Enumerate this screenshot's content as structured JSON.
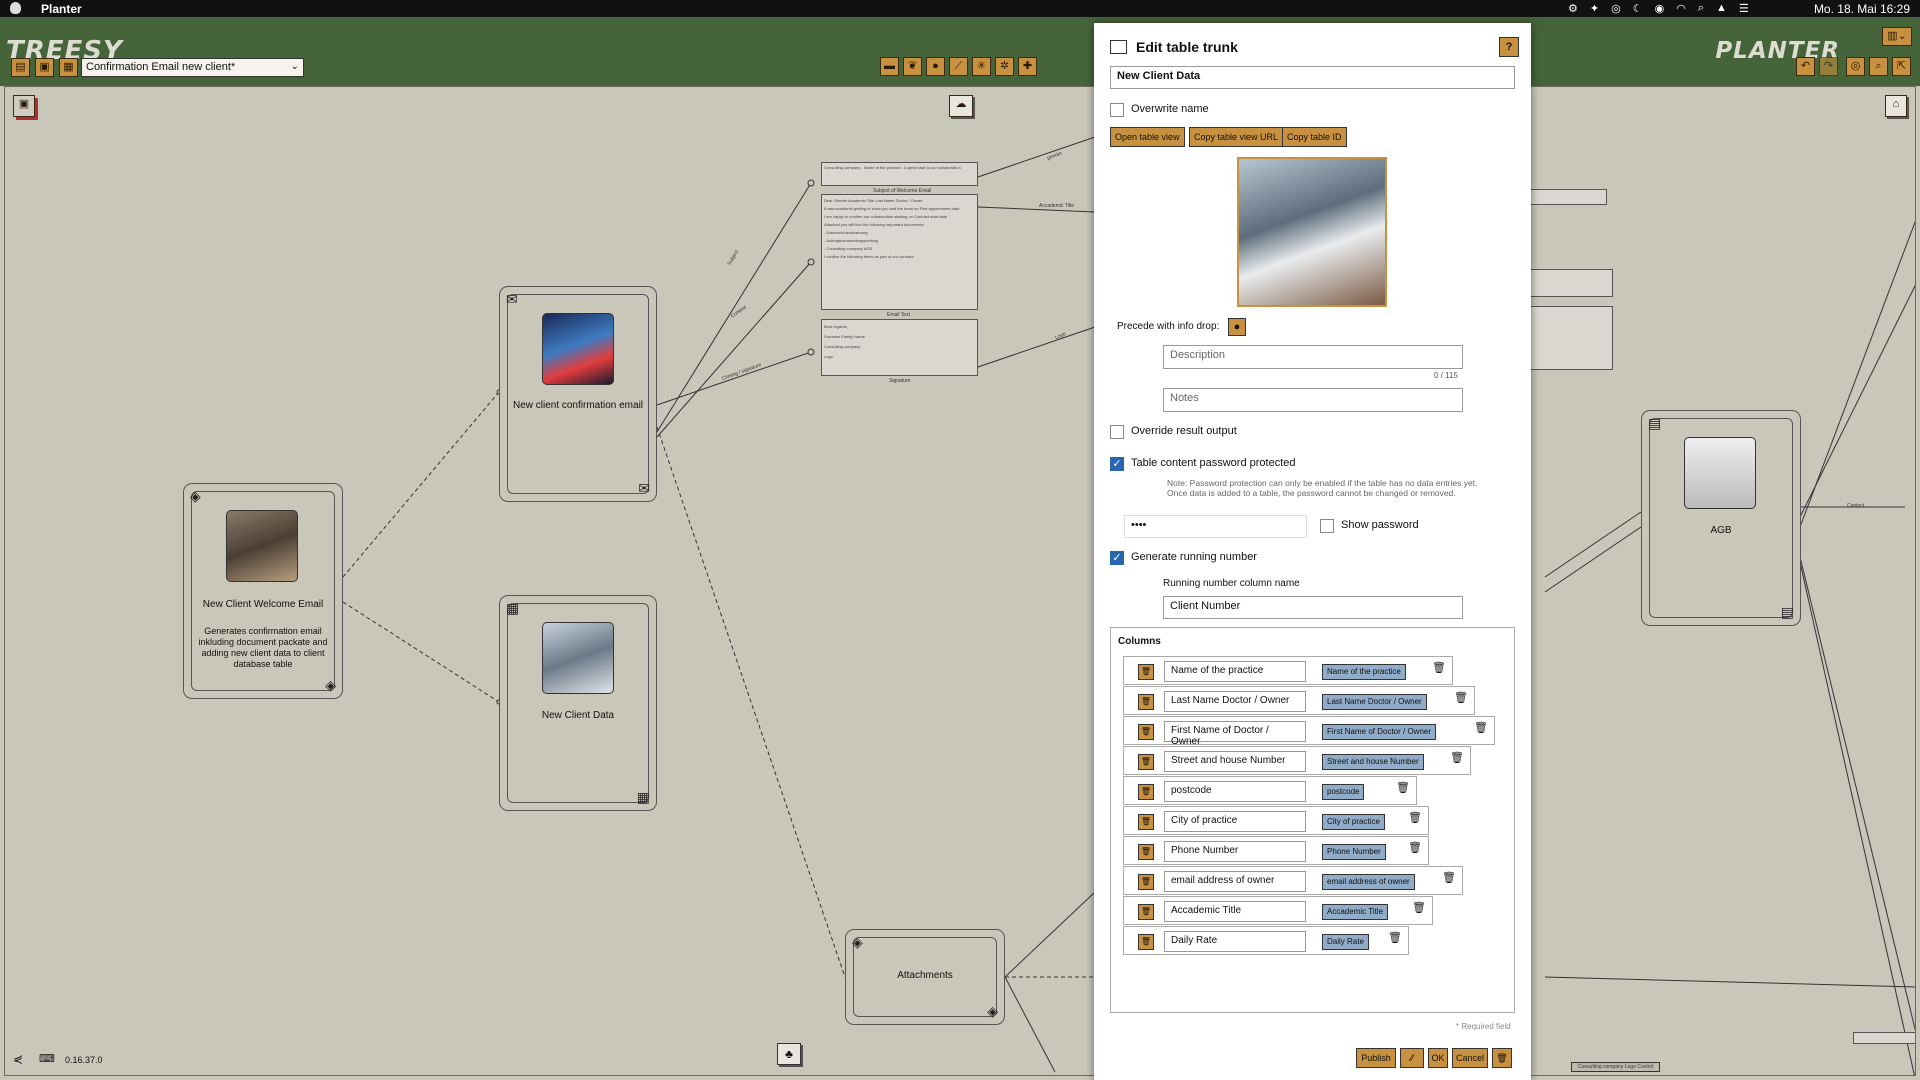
{
  "menubar": {
    "app_name": "Planter",
    "clock": "Mo. 18. Mai  16:29"
  },
  "appbar": {
    "logo": "TREESY",
    "planter_logo": "PLANTER",
    "document_select": "Confirmation Email new client*"
  },
  "canvas": {
    "version": "0.16.37.0",
    "nodes": {
      "welcome": {
        "title": "New Client Welcome Email",
        "desc": "Generates confirmation email inkluding document packate and adding new client data to client database table"
      },
      "confirm": {
        "title": "New client confirmation email"
      },
      "data": {
        "title": "New Client Data"
      },
      "attach": {
        "title": "Attachments"
      },
      "agb": {
        "title": "AGB"
      }
    },
    "doc_labels": {
      "subject": "Subject of Welcome Email",
      "email_text": "Email Text",
      "signature": "Signature"
    },
    "doc_text": {
      "subject": "Consulting company - Name of the practice - A great start to our collaboration",
      "body1": "Dear  Gender  Academic Title  Last Name Doctor / Owner,",
      "body2": "It was wonderful getting to know you and the team on  First appointment date",
      "body3": "I am happy to confirm our collaboration starting on  Contract start date",
      "body4": "Attached you will find the following important documents:",
      "body5": "- Datenschutzerklaerung",
      "body6": "- Auftragsverarbeitungsvertrag",
      "body7": "- Consulting company AGB",
      "body8": "I confirm the following items as part of our contract:",
      "sig1": "Best regards,",
      "sig2": "Surname Family Name",
      "sig3": "Consulting company",
      "sig4": "Logo"
    },
    "wire_labels": {
      "gender": "gender",
      "academic": "Accademic Title",
      "subject": "Subject",
      "content": "Content",
      "closing": "Closing / signature",
      "logo": "Logo",
      "contact": "Contact",
      "right_consult": "Consulting company Logo Control"
    }
  },
  "dialog": {
    "title": "Edit table trunk",
    "help": "?",
    "name_value": "New Client Data",
    "overwrite_label": "Overwrite name",
    "btn_open": "Open table view",
    "btn_copy_url": "Copy table view URL",
    "btn_copy_id": "Copy table ID",
    "precede_label": "Precede with info drop:",
    "description_placeholder": "Description",
    "description_counter": "0 / 115",
    "notes_placeholder": "Notes",
    "override_label": "Override result output",
    "password_label": "Table content password protected",
    "password_note": "Note: Password protection can only be enabled if the table has no data entries yet. Once data is added to a table, the password cannot be changed or removed.",
    "password_value": "••••",
    "show_password_label": "Show password",
    "running_label": "Generate running number",
    "running_col_label": "Running number column name",
    "running_col_value": "Client Number",
    "columns_title": "Columns",
    "columns": [
      {
        "name": "Name of the practice",
        "tag": "Name of the practice"
      },
      {
        "name": "Last Name Doctor / Owner",
        "tag": "Last Name Doctor / Owner"
      },
      {
        "name": "First Name of Doctor / Owner",
        "tag": "First Name of Doctor / Owner"
      },
      {
        "name": "Street and house Number",
        "tag": "Street and house Number"
      },
      {
        "name": "postcode",
        "tag": "postcode"
      },
      {
        "name": "City of practice",
        "tag": "City of practice"
      },
      {
        "name": "Phone Number",
        "tag": "Phone Number"
      },
      {
        "name": "email address of owner",
        "tag": "email address of owner"
      },
      {
        "name": "Accademic Title",
        "tag": "Accademic Title"
      },
      {
        "name": "Daily Rate",
        "tag": "Daily Rate"
      }
    ],
    "required_note": "* Required field",
    "btn_publish": "Publish",
    "btn_ok": "OK",
    "btn_cancel": "Cancel"
  },
  "colors": {
    "appbar": "#46643a",
    "canvas": "#c9c6ba",
    "orange_button": "#c8913f",
    "tag_blue": "#90acc8",
    "checkbox_blue": "#2866b2"
  }
}
